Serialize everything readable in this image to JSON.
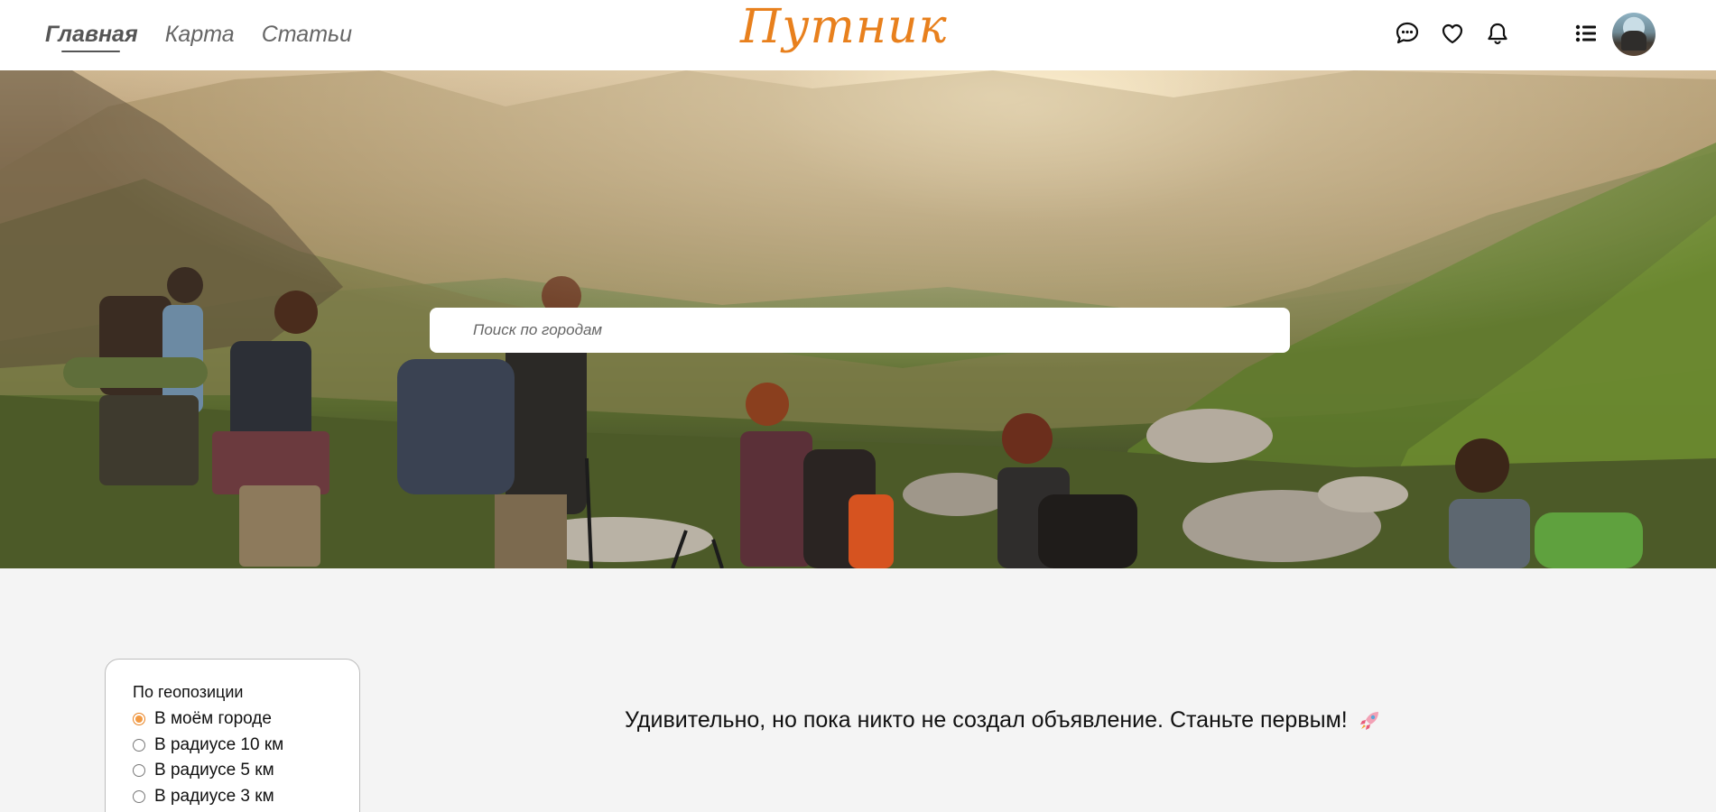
{
  "nav": {
    "items": [
      {
        "label": "Главная",
        "active": true
      },
      {
        "label": "Карта",
        "active": false
      },
      {
        "label": "Статьи",
        "active": false
      }
    ]
  },
  "logo": {
    "text": "Путник",
    "color": "#e8801d"
  },
  "header_icons": [
    "chat-bubble-icon",
    "heart-icon",
    "bell-icon",
    "list-icon"
  ],
  "search": {
    "placeholder": "Поиск по городам",
    "value": ""
  },
  "filter": {
    "title": "По геопозиции",
    "options": [
      {
        "label": "В моём городе",
        "selected": true
      },
      {
        "label": "В радиусе 10 км",
        "selected": false
      },
      {
        "label": "В радиусе 5 км",
        "selected": false
      },
      {
        "label": "В радиусе 3 км",
        "selected": false
      }
    ]
  },
  "empty_state": {
    "message": "Удивительно, но пока никто не создал объявление. Станьте первым!",
    "icon": "rocket-icon"
  },
  "colors": {
    "accent": "#e8801d",
    "background": "#f4f4f4"
  }
}
